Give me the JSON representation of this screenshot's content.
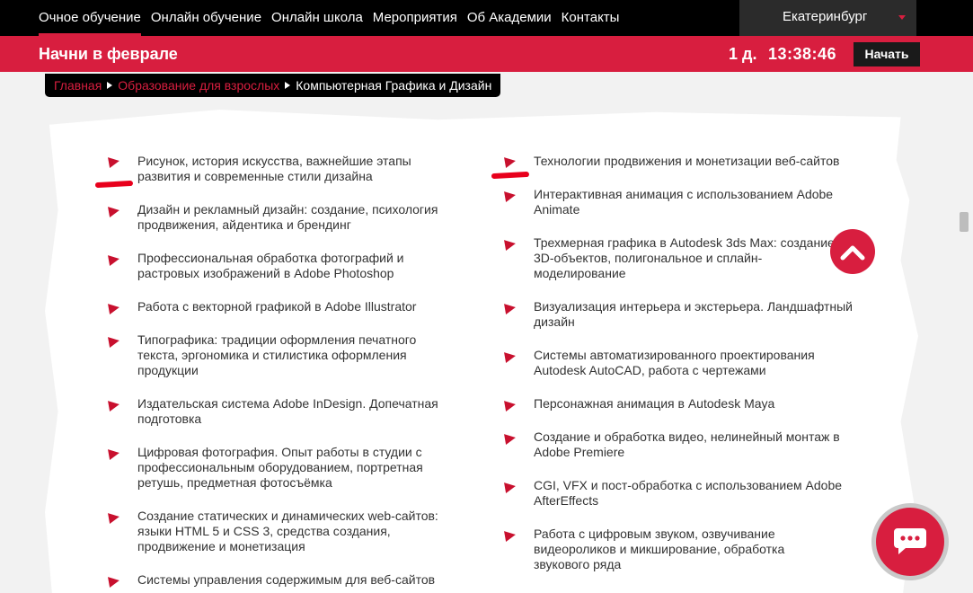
{
  "topnav": {
    "items": [
      {
        "label": "Очное обучение",
        "active": true
      },
      {
        "label": "Онлайн обучение"
      },
      {
        "label": "Онлайн школа"
      },
      {
        "label": "Мероприятия"
      },
      {
        "label": "Об Академии"
      },
      {
        "label": "Контакты"
      }
    ],
    "city": "Екатеринбург"
  },
  "promo": {
    "title": "Начни в феврале",
    "days": "1 д.",
    "timer": "13:38:46",
    "start_label": "Начать"
  },
  "breadcrumb": {
    "home": "Главная",
    "section": "Образование для взрослых",
    "current": "Компьютерная Графика и Дизайн"
  },
  "left_list": [
    {
      "text": "Рисунок, история искусства, важнейшие этапы развития и современные стили дизайна"
    },
    {
      "text": "Дизайн и рекламный дизайн: создание, психология продвижения, айдентика и брендинг"
    },
    {
      "text": "Профессиональная обработка фотографий и растровых изображений в Adobe Photoshop"
    },
    {
      "text": "Работа с векторной графикой в Adobe Illustrator"
    },
    {
      "text": "Типографика: традиции оформления печатного текста, эргономика и стилистика оформления продукции"
    },
    {
      "text": "Издательская система Adobe InDesign. Допечатная подготовка"
    },
    {
      "text": "Цифровая фотография. Опыт работы в студии с профессиональным оборудованием, портретная ретушь, предметная фотосъёмка"
    },
    {
      "text": "Создание статических и динамических web-сайтов: языки HTML 5 и CSS 3, средства создания, продвижение и монетизация"
    },
    {
      "text": "Системы управления содержимым для веб-сайтов"
    }
  ],
  "right_list": [
    {
      "text": "Технологии продвижения и монетизации веб-сайтов"
    },
    {
      "text": "Интерактивная анимация с использованием Adobe Animate"
    },
    {
      "text": "Трехмерная графика в Autodesk 3ds Max: создание 3D-объектов, полигональное и сплайн-моделирование"
    },
    {
      "text": "Визуализация интерьера и экстерьера. Ландшафтный дизайн"
    },
    {
      "text": "Системы автоматизированного проектирования Autodesk AutoCAD, работа с чертежами"
    },
    {
      "text": "Персонажная анимация в Autodesk Maya"
    },
    {
      "text": "Создание и обработка видео, нелинейный монтаж в Adobe Premiere"
    },
    {
      "text": "CGI, VFX и пост-обработка с использованием Adobe AfterEffects"
    },
    {
      "text": "Работа с цифровым звуком, озвучивание видеороликов и микширование, обработка звукового ряда"
    }
  ],
  "colors": {
    "accent": "#d81e3f",
    "nav_bg": "#000000",
    "text": "#333333"
  }
}
